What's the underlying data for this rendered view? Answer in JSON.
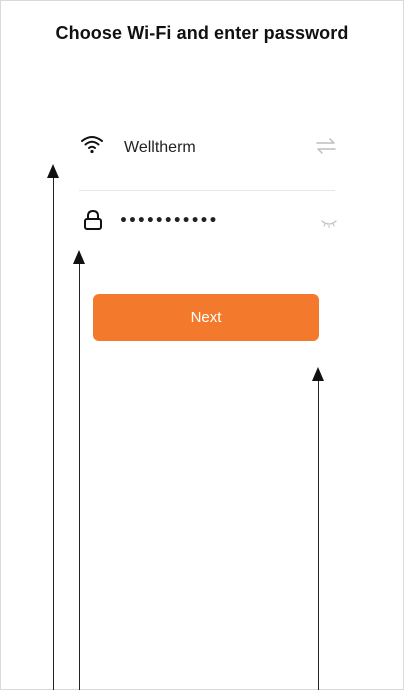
{
  "header": {
    "title": "Choose Wi-Fi and enter password"
  },
  "wifi": {
    "icon": "wifi-icon",
    "network_name": "Welltherm",
    "switch_icon": "swap-network-icon"
  },
  "password": {
    "icon": "lock-icon",
    "masked_value": "•••••••••••",
    "visibility_icon": "eye-closed-icon"
  },
  "actions": {
    "next_label": "Next"
  },
  "annotations": {
    "arrow_color": "#111111",
    "count": 3
  },
  "colors": {
    "accent": "#f37a2c",
    "text": "#222222",
    "divider": "#e6e6e6"
  }
}
